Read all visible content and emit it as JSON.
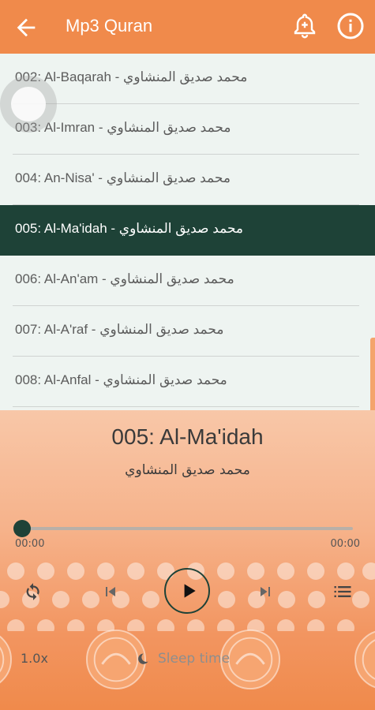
{
  "appbar": {
    "title": "Mp3 Quran"
  },
  "list": {
    "items": [
      {
        "label": "002: Al-Baqarah - محمد صديق المنشاوي"
      },
      {
        "label": "003: Al-Imran - محمد صديق المنشاوي"
      },
      {
        "label": "004: An-Nisa' - محمد صديق المنشاوي"
      },
      {
        "label": "005: Al-Ma'idah - محمد صديق المنشاوي",
        "active": true
      },
      {
        "label": "006: Al-An'am - محمد صديق المنشاوي"
      },
      {
        "label": "007: Al-A'raf - محمد صديق المنشاوي"
      },
      {
        "label": "008: Al-Anfal - محمد صديق المنشاوي"
      }
    ]
  },
  "player": {
    "title": "005: Al-Ma'idah",
    "reciter": "محمد صديق المنشاوي",
    "time_start": "00:00",
    "time_end": "00:00",
    "progress": 0,
    "speed": "1.0x",
    "sleep_label": "Sleep time"
  },
  "colors": {
    "accent": "#f08a4b",
    "dark": "#1e4237"
  },
  "icons": [
    "back-arrow-icon",
    "bell-plus-icon",
    "info-icon",
    "repeat-icon",
    "previous-icon",
    "play-icon",
    "next-icon",
    "playlist-icon",
    "moon-icon"
  ]
}
